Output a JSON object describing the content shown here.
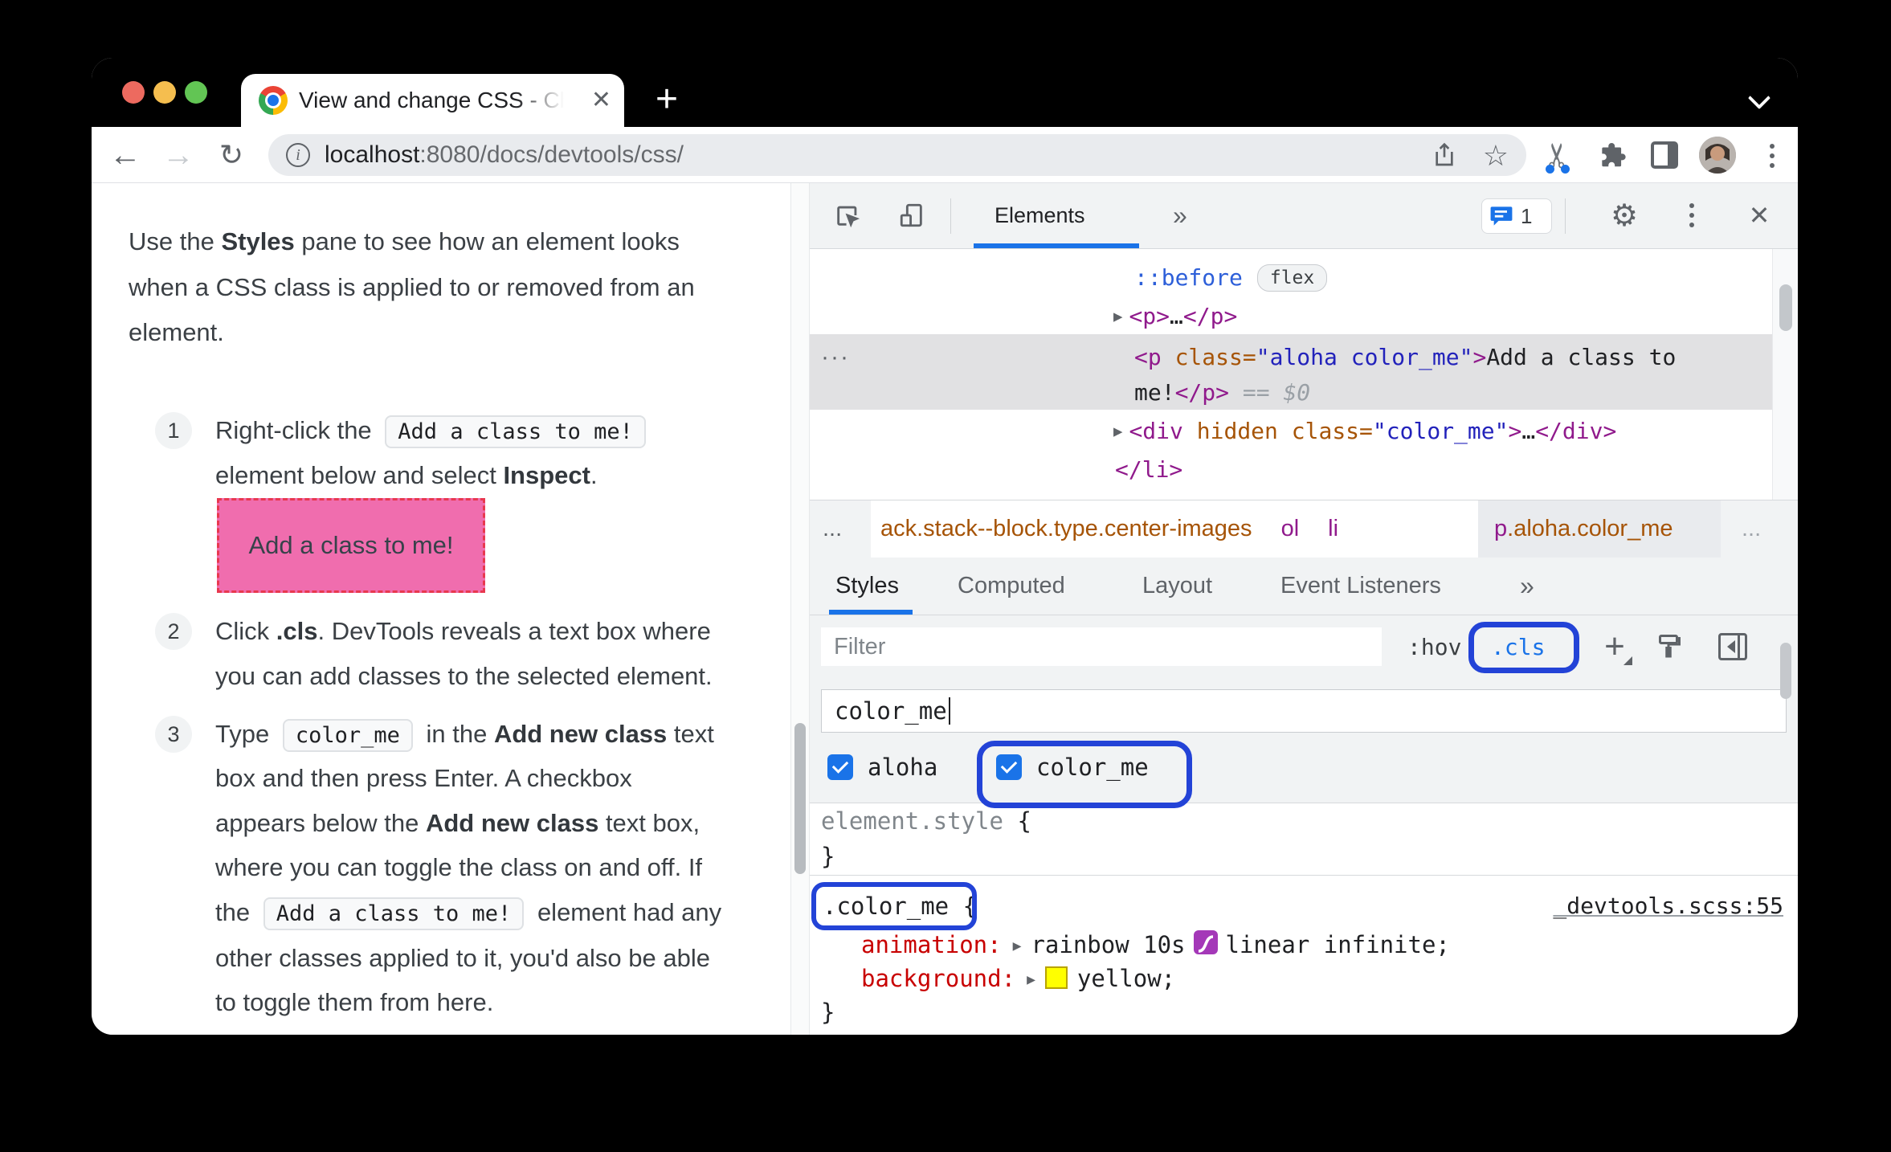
{
  "colors": {
    "accent": "#1a73e8",
    "annotation_ring": "#2343d7",
    "pink_box_bg": "#f06dae",
    "pink_box_border": "#e8384f",
    "property_red": "#c80000",
    "tag_purple": "#901a8c",
    "attr_orange": "#a65407",
    "value_blue": "#2222bb",
    "selection_bg": "#e1e1e3",
    "yellow_swatch": "#ffff00"
  },
  "glyphs": {
    "back": "←",
    "forward": "→",
    "reload": "↻",
    "star": "☆",
    "scissors": "✂",
    "plus": "+",
    "close": "✕",
    "more_tabs": "»",
    "gear": "⚙",
    "gutter_dots": "···",
    "expand_arrow": "▶",
    "info": "i"
  },
  "browser": {
    "tab_title": "View and change CSS - Chrome",
    "url_host": "localhost",
    "url_path": ":8080/docs/devtools/css/"
  },
  "doc": {
    "intro": [
      [
        {
          "t": "Use the "
        },
        {
          "t": "Styles",
          "c": "b"
        },
        {
          "t": " pane to see how an element looks"
        }
      ],
      [
        {
          "t": "when a CSS class is applied to or removed from an"
        }
      ],
      [
        {
          "t": "element."
        }
      ]
    ],
    "steps": [
      {
        "num": "1",
        "lines": [
          [
            {
              "t": "Right-click the "
            },
            {
              "t": "Add a class to me!",
              "c": "code"
            }
          ],
          [
            {
              "t": "element below and select "
            },
            {
              "t": "Inspect",
              "c": "b"
            },
            {
              "t": "."
            }
          ]
        ]
      },
      {
        "num": "2",
        "lines": [
          [
            {
              "t": "Click "
            },
            {
              "t": ".cls",
              "c": "b"
            },
            {
              "t": ". DevTools reveals a text box where"
            }
          ],
          [
            {
              "t": "you can add classes to the selected element."
            }
          ]
        ]
      },
      {
        "num": "3",
        "lines": [
          [
            {
              "t": "Type "
            },
            {
              "t": "color_me",
              "c": "code"
            },
            {
              "t": " in the "
            },
            {
              "t": "Add new class",
              "c": "b"
            },
            {
              "t": " text"
            }
          ],
          [
            {
              "t": "box and then press Enter. A checkbox"
            }
          ],
          [
            {
              "t": "appears below the "
            },
            {
              "t": "Add new class",
              "c": "b"
            },
            {
              "t": " text box,"
            }
          ],
          [
            {
              "t": "where you can toggle the class on and off. If"
            }
          ],
          [
            {
              "t": "the "
            },
            {
              "t": "Add a class to me!",
              "c": "code"
            },
            {
              "t": " element had any"
            }
          ],
          [
            {
              "t": "other classes applied to it, you'd also be able"
            }
          ],
          [
            {
              "t": "to toggle them from here."
            }
          ]
        ]
      }
    ],
    "demo_box": "Add a class to me!"
  },
  "devtools": {
    "toolbar": {
      "tab": "Elements",
      "issues_count": "1"
    },
    "dom": {
      "pseudo": [
        {
          "t": "::before",
          "c": "pseudo"
        },
        {
          "t": "flex",
          "c": "badge"
        }
      ],
      "p_collapsed": [
        {
          "c": "arrow"
        },
        {
          "t": "<p>",
          "c": "tag"
        },
        {
          "t": "…",
          "c": "dark"
        },
        {
          "t": "</p>",
          "c": "tag"
        }
      ],
      "selected_1": [
        {
          "t": "<p",
          "c": "tag"
        },
        {
          "t": " class=",
          "c": "attr"
        },
        {
          "t": "\"aloha color_me\"",
          "c": "val"
        },
        {
          "t": ">",
          "c": "tag"
        },
        {
          "t": "Add a class to",
          "c": "dark"
        }
      ],
      "selected_2": [
        {
          "t": "me!",
          "c": "dark"
        },
        {
          "t": "</p>",
          "c": "tag"
        },
        {
          "t": " == ",
          "c": "gray"
        },
        {
          "t": "$0",
          "c": "grayit"
        }
      ],
      "div_hidden": [
        {
          "c": "arrow"
        },
        {
          "t": "<div",
          "c": "tag"
        },
        {
          "t": " hidden class=",
          "c": "attr"
        },
        {
          "t": "\"color_me\"",
          "c": "val"
        },
        {
          "t": ">",
          "c": "tag"
        },
        {
          "t": "…",
          "c": "dark"
        },
        {
          "t": "</div>",
          "c": "tag"
        }
      ],
      "li_close": [
        {
          "t": "</li>",
          "c": "tag"
        }
      ]
    },
    "crumbs": {
      "more_left": "...",
      "seg": [
        {
          "t": "ack.stack--block.type.center-images",
          "c": "cls"
        },
        {
          "t": "ol",
          "c": "tag gapl"
        },
        {
          "t": "li",
          "c": "tag gapl"
        }
      ],
      "last": [
        {
          "t": "p",
          "c": "tag"
        },
        {
          "t": ".aloha.color_me",
          "c": "cls"
        }
      ],
      "more_right": "..."
    },
    "tabs": [
      "Styles",
      "Computed",
      "Layout",
      "Event Listeners"
    ],
    "filter_placeholder": "Filter",
    "hov_label": ":hov",
    "cls_label": ".cls",
    "class_input": "color_me",
    "classes": [
      {
        "label": "aloha",
        "checked": true
      },
      {
        "label": "color_me",
        "checked": true
      }
    ],
    "rules": {
      "element_style": {
        "selector_tokens": [
          {
            "t": "element.style",
            "c": "dim"
          },
          {
            "t": " {",
            "c": "dark"
          }
        ],
        "close": "}"
      },
      "color_me": {
        "selector": ".color_me",
        "open_brace": " {",
        "source": "_devtools.scss:55",
        "decl_animation": [
          {
            "t": "animation:",
            "c": "red"
          },
          {
            "c": "arrow-sm"
          },
          {
            "t": "rainbow 10s",
            "c": "dark"
          },
          {
            "c": "bez"
          },
          {
            "t": "linear infinite;",
            "c": "dark"
          }
        ],
        "decl_background": [
          {
            "t": "background:",
            "c": "red"
          },
          {
            "c": "arrow-sm"
          },
          {
            "c": "swatch"
          },
          {
            "t": "yellow;",
            "c": "dark"
          }
        ],
        "close": "}"
      }
    }
  }
}
